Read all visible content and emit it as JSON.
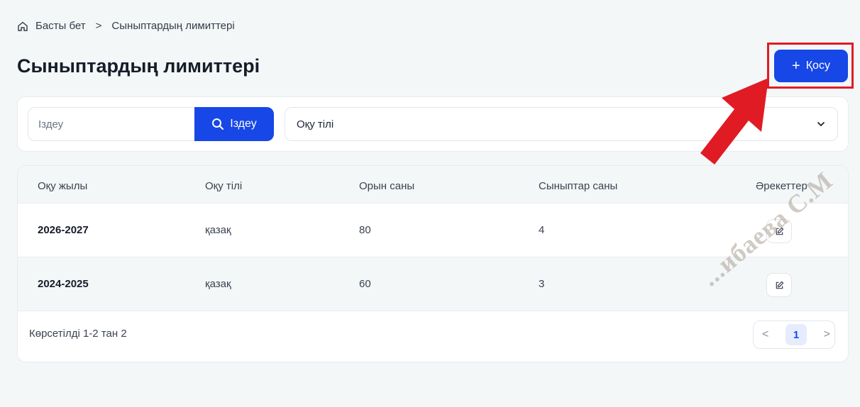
{
  "breadcrumb": {
    "home_label": "Басты бет",
    "separator": ">",
    "current": "Сыныптардың лимиттері"
  },
  "page": {
    "title": "Сыныптардың лимиттері"
  },
  "toolbar": {
    "add_label": "Қосу",
    "add_icon": "+"
  },
  "filters": {
    "search_placeholder": "Іздеу",
    "search_button_label": "Іздеу",
    "language_select_value": "Оқу тілі"
  },
  "table": {
    "columns": [
      "Оқу жылы",
      "Оқу тілі",
      "Орын саны",
      "Сыныптар саны",
      "Әрекеттер"
    ],
    "rows": [
      {
        "year": "2026-2027",
        "language": "қазақ",
        "seats": "80",
        "classes": "4"
      },
      {
        "year": "2024-2025",
        "language": "қазақ",
        "seats": "60",
        "classes": "3"
      }
    ]
  },
  "pagination": {
    "summary": "Көрсетілді 1-2 тан 2",
    "prev": "<",
    "current_page": "1",
    "next": ">"
  },
  "watermark": "...ибаева С.М",
  "colors": {
    "accent": "#1747e6",
    "highlight": "#e01b24",
    "background": "#f4f7f8"
  },
  "icons": [
    "home-icon",
    "search-icon",
    "chevron-down-icon",
    "edit-icon",
    "plus-icon"
  ]
}
